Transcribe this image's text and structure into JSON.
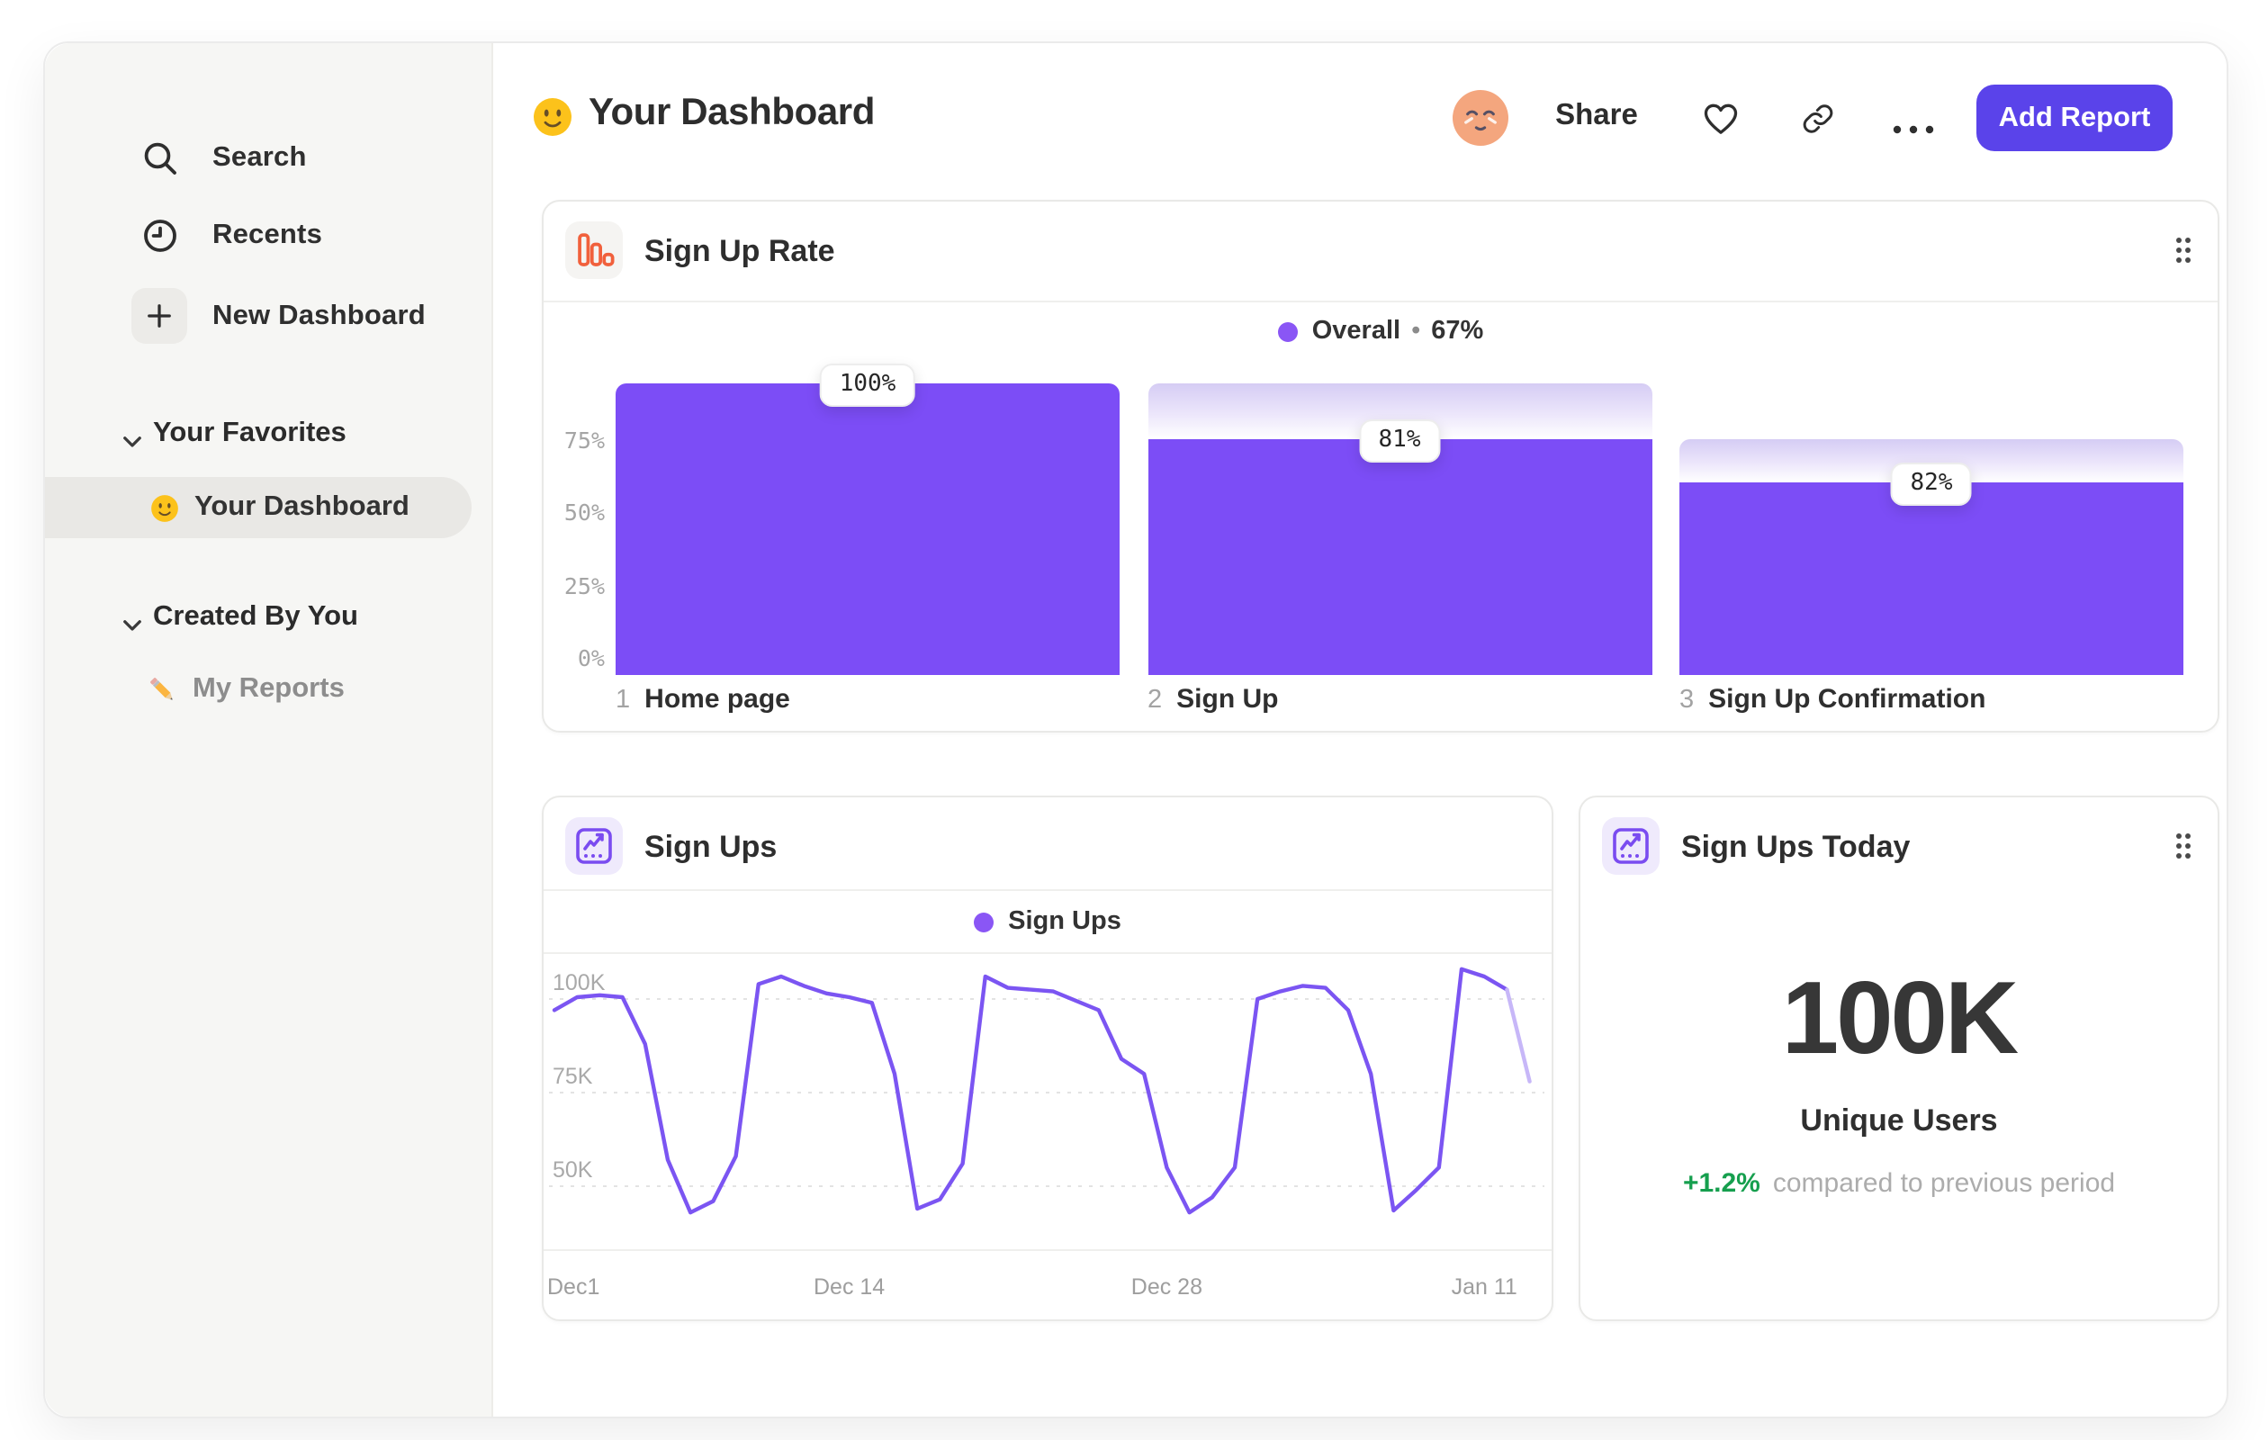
{
  "sidebar": {
    "items": [
      {
        "icon": "search-icon",
        "label": "Search"
      },
      {
        "icon": "recents-icon",
        "label": "Recents"
      },
      {
        "icon": "plus-icon",
        "label": "New Dashboard"
      }
    ],
    "sections": [
      {
        "label": "Your Favorites",
        "items": [
          {
            "icon": "smiley-emoji",
            "label": "Your Dashboard",
            "selected": true
          }
        ]
      },
      {
        "label": "Created By You",
        "items": [
          {
            "icon": "pencil-emoji",
            "label": "My Reports",
            "selected": false
          }
        ]
      }
    ]
  },
  "header": {
    "title_emoji": "slightly-smiling-face",
    "title": "Your Dashboard",
    "share_label": "Share",
    "add_report_label": "Add Report"
  },
  "signup_rate_card": {
    "title": "Sign Up Rate",
    "legend_series": "Overall",
    "legend_sep": "•",
    "legend_value": "67%",
    "y_axis_labels": [
      "75%",
      "50%",
      "25%",
      "0%"
    ],
    "chart_data": {
      "type": "bar",
      "subtype": "funnel",
      "categories": [
        "Home page",
        "Sign Up",
        "Sign Up Confirmation"
      ],
      "step_numbers": [
        "1",
        "2",
        "3"
      ],
      "step_conversion_pct": [
        100,
        81,
        82
      ],
      "cumulative_pct": [
        100,
        81,
        66
      ],
      "carryover_pct": [
        100,
        100,
        81
      ],
      "data_labels": [
        "100%",
        "81%",
        "82%"
      ],
      "overall_conversion": "67%",
      "ylim": [
        0,
        100
      ],
      "ytick_values": [
        75,
        50,
        25,
        0
      ],
      "grid": false,
      "legend_position": "top-center",
      "bar_color": "#7c4df6"
    }
  },
  "signups_card": {
    "title": "Sign Ups",
    "legend": "Sign Ups",
    "chart_data": {
      "type": "line",
      "series": [
        {
          "name": "Sign Ups",
          "values": [
            97,
            100.5,
            101,
            100.5,
            88,
            57,
            43,
            46,
            58,
            104,
            106,
            103.5,
            101.5,
            100.5,
            99,
            80,
            44,
            46.5,
            56,
            106,
            103,
            102.5,
            102,
            99.5,
            97,
            84,
            80,
            55,
            43,
            47,
            55,
            100,
            102,
            103.5,
            103,
            97,
            80,
            43.5,
            49,
            55,
            108,
            106,
            102.5,
            78
          ]
        }
      ],
      "unit": "K",
      "x_start": "Dec 1",
      "x_tick_labels": [
        "Dec1",
        "Dec 14",
        "Dec 28",
        "Jan 11"
      ],
      "x_tick_days": [
        0,
        13,
        27,
        41
      ],
      "yticks": [
        100,
        75,
        50
      ],
      "ytick_labels": [
        "100K",
        "75K",
        "50K"
      ],
      "ylim": [
        40,
        112
      ],
      "grid": "dashed-horizontal",
      "legend_position": "top-center",
      "line_color": "#7b55f2",
      "faded_line_color": "#c7b7f8",
      "faded_from_index": 42
    }
  },
  "signups_today_card": {
    "title": "Sign Ups Today",
    "value": "100K",
    "value_label": "Unique Users",
    "delta": "+1.2%",
    "delta_note": "compared to previous period"
  },
  "colors": {
    "accent_purple": "#7c4df6",
    "button_purple": "#5a43ea",
    "positive_green": "#169f4e",
    "orange_icon": "#f1603c",
    "sidebar_bg": "#f6f6f4"
  }
}
